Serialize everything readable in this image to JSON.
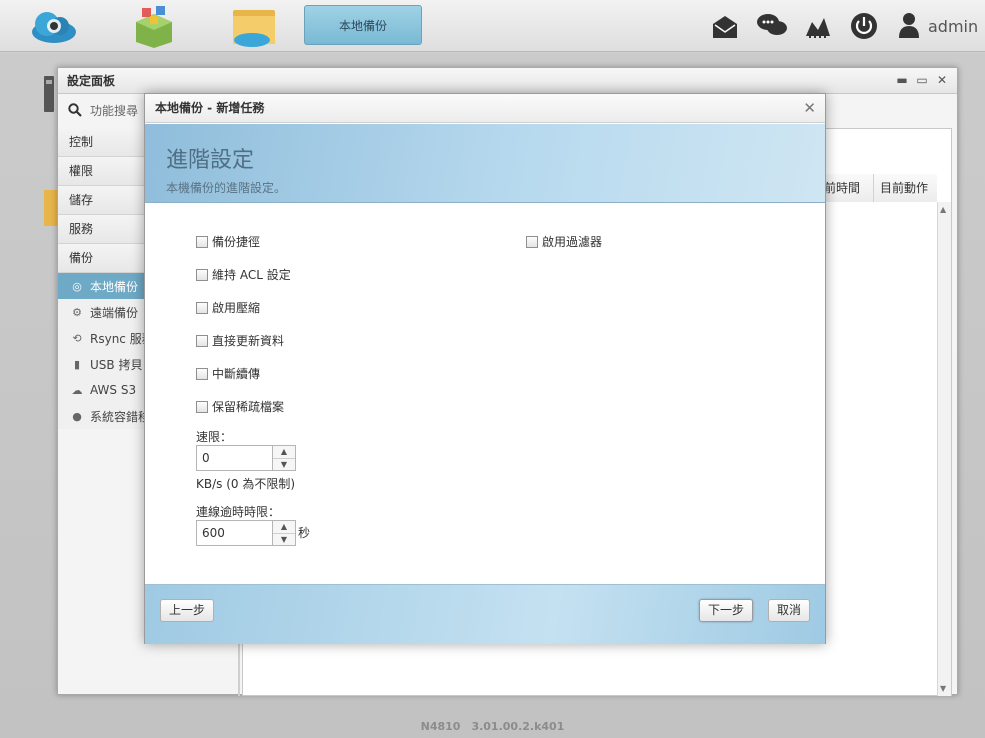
{
  "taskbar": {
    "active_app": "本地備份",
    "user": "admin",
    "icons": [
      "cloud-app-icon",
      "app-center-icon",
      "file-manager-icon",
      "mail-icon",
      "chat-icon",
      "signal-icon",
      "power-icon",
      "user-icon"
    ]
  },
  "panel": {
    "title": "設定面板",
    "search_placeholder": "功能搜尋",
    "categories": [
      "控制",
      "權限",
      "儲存",
      "服務",
      "備份"
    ],
    "items": [
      {
        "label": "本地備份",
        "icon": "backup-icon"
      },
      {
        "label": "遠端備份",
        "icon": "remote-backup-icon"
      },
      {
        "label": "Rsync 服務",
        "icon": "sync-icon"
      },
      {
        "label": "USB 拷貝",
        "icon": "usb-icon"
      },
      {
        "label": "AWS S3",
        "icon": "cloud-icon"
      },
      {
        "label": "系統容錯移轉",
        "icon": "failover-icon"
      }
    ],
    "columns": [
      "前時間",
      "目前動作"
    ]
  },
  "modal": {
    "title": "本地備份 - 新增任務",
    "heading": "進階設定",
    "subheading": "本機備份的進階設定。",
    "options_left": [
      "備份捷徑",
      "維持 ACL 設定",
      "啟用壓縮",
      "直接更新資料",
      "中斷續傳",
      "保留稀疏檔案"
    ],
    "options_right": [
      "啟用過濾器"
    ],
    "speed": {
      "label": "速限：",
      "value": "0",
      "hint": "KB/s (0 為不限制)"
    },
    "timeout": {
      "label": "連線逾時時限：",
      "value": "600",
      "unit": "秒"
    },
    "buttons": {
      "prev": "上一步",
      "next": "下一步",
      "cancel": "取消"
    }
  },
  "footer": {
    "version": "N4810　3.01.00.2.k401"
  }
}
